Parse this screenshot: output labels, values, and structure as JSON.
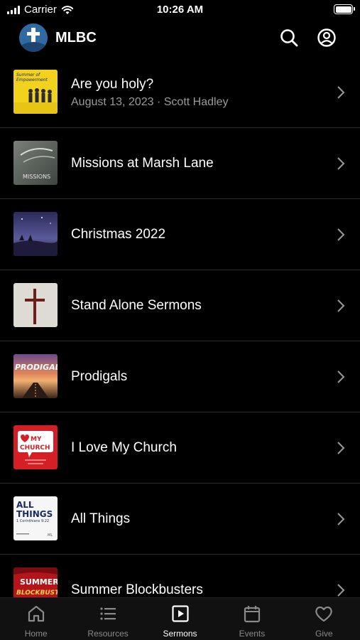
{
  "status_bar": {
    "carrier": "Carrier",
    "time": "10:26 AM"
  },
  "header": {
    "title": "MLBC",
    "logo_icon": "church-logo-icon"
  },
  "sermons": [
    {
      "title": "Are you holy?",
      "subtitle": "August 13, 2023 · Scott Hadley",
      "thumb_text": "Summer of Empowerment",
      "thumb_icon": "summer-of-empowerment-thumbnail"
    },
    {
      "title": "Missions at Marsh Lane",
      "subtitle": "",
      "thumb_text": "MISSIONS",
      "thumb_icon": "missions-thumbnail"
    },
    {
      "title": "Christmas 2022",
      "subtitle": "",
      "thumb_text": "",
      "thumb_icon": "christmas-thumbnail"
    },
    {
      "title": "Stand Alone Sermons",
      "subtitle": "",
      "thumb_text": "",
      "thumb_icon": "cross-thumbnail"
    },
    {
      "title": "Prodigals",
      "subtitle": "",
      "thumb_text": "PRODIGAL",
      "thumb_icon": "prodigals-thumbnail"
    },
    {
      "title": "I Love My Church",
      "subtitle": "",
      "thumb_text": "I ♥ MY CHURCH",
      "thumb_icon": "i-love-my-church-thumbnail"
    },
    {
      "title": "All Things",
      "subtitle": "",
      "thumb_text": "ALL THINGS",
      "thumb_text_2": "1 Corinthians 9:22",
      "thumb_icon": "all-things-thumbnail"
    },
    {
      "title": "Summer Blockbusters",
      "subtitle": "",
      "thumb_text": "SUMMER",
      "thumb_icon": "summer-blockbusters-thumbnail"
    }
  ],
  "tabs": [
    {
      "label": "Home",
      "icon": "home-icon"
    },
    {
      "label": "Resources",
      "icon": "list-icon"
    },
    {
      "label": "Sermons",
      "icon": "play-icon",
      "active": true
    },
    {
      "label": "Events",
      "icon": "calendar-icon"
    },
    {
      "label": "Give",
      "icon": "heart-icon"
    }
  ],
  "colors": {
    "background": "#000000",
    "tab_bar": "#111111",
    "subtitle": "#9a9a9a",
    "inactive_tab": "#8a8a8a"
  }
}
